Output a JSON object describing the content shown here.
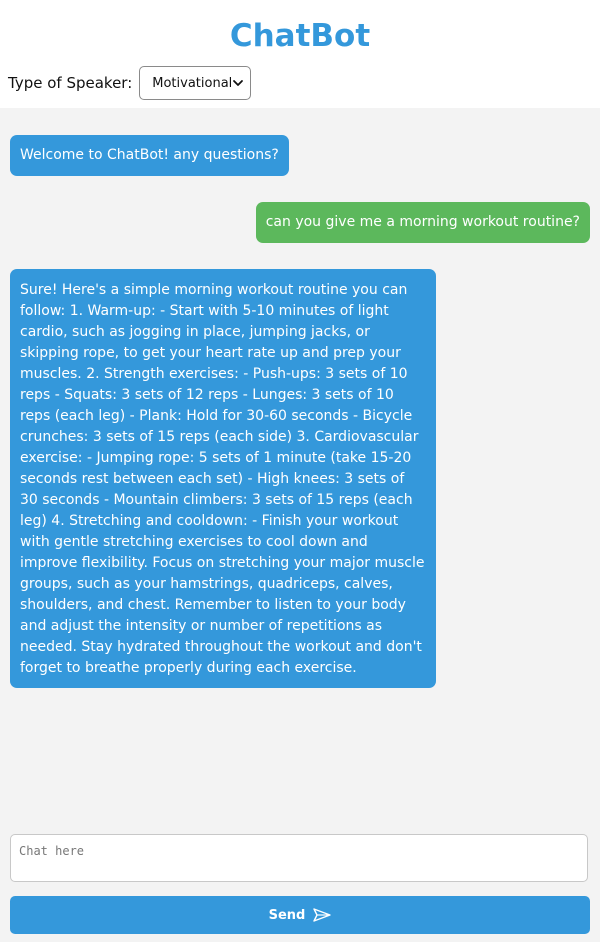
{
  "app": {
    "title": "ChatBot"
  },
  "speaker": {
    "label": "Type of Speaker:",
    "selected": "Motivational"
  },
  "messages": [
    {
      "role": "bot",
      "text": "Welcome to ChatBot! any questions?"
    },
    {
      "role": "user",
      "text": "can you give me a morning workout routine?"
    },
    {
      "role": "bot",
      "text": "Sure! Here's a simple morning workout routine you can follow: 1. Warm-up: - Start with 5-10 minutes of light cardio, such as jogging in place, jumping jacks, or skipping rope, to get your heart rate up and prep your muscles. 2. Strength exercises: - Push-ups: 3 sets of 10 reps - Squats: 3 sets of 12 reps - Lunges: 3 sets of 10 reps (each leg) - Plank: Hold for 30-60 seconds - Bicycle crunches: 3 sets of 15 reps (each side) 3. Cardiovascular exercise: - Jumping rope: 5 sets of 1 minute (take 15-20 seconds rest between each set) - High knees: 3 sets of 30 seconds - Mountain climbers: 3 sets of 15 reps (each leg) 4. Stretching and cooldown: - Finish your workout with gentle stretching exercises to cool down and improve flexibility. Focus on stretching your major muscle groups, such as your hamstrings, quadriceps, calves, shoulders, and chest. Remember to listen to your body and adjust the intensity or number of repetitions as needed. Stay hydrated throughout the workout and don't forget to breathe properly during each exercise."
    }
  ],
  "input": {
    "placeholder": "Chat here"
  },
  "send": {
    "label": "Send",
    "icon": "send-icon"
  },
  "colors": {
    "accent": "#3498db",
    "user_bubble": "#5cb85c",
    "background": "#f3f3f3"
  }
}
